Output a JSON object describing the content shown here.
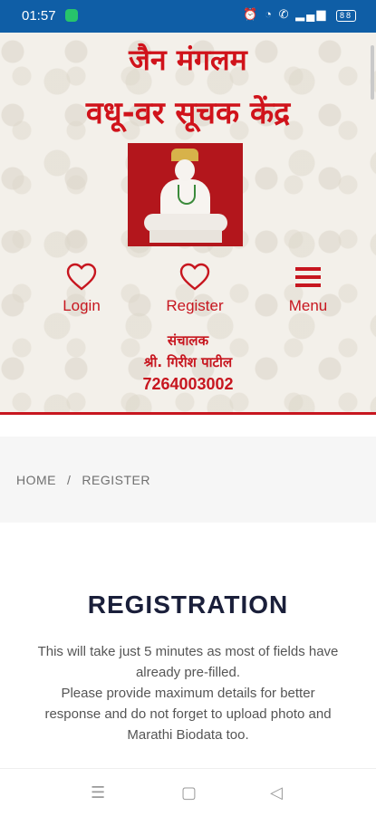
{
  "status_bar": {
    "time": "01:57",
    "battery": "88",
    "icons": [
      "alarm-icon",
      "wifi-icon",
      "call-icon",
      "signal-icon",
      "battery-icon"
    ]
  },
  "header": {
    "title_line1": "जैन मंगलम",
    "title_line2": "वधू-वर सूचक केंद्र",
    "nav": {
      "login": "Login",
      "register": "Register",
      "menu": "Menu"
    },
    "director": {
      "label": "संचालक",
      "name": "श्री. गिरीश पाटील",
      "phone": "7264003002"
    }
  },
  "breadcrumb": {
    "home": "HOME",
    "separator": "/",
    "current": "REGISTER"
  },
  "main": {
    "heading": "REGISTRATION",
    "description_line1": "This will take just 5 minutes as most of fields have",
    "description_line2": "already pre-filled.",
    "description_line3": "Please provide maximum details for better",
    "description_line4": "response and do not forget to upload photo and",
    "description_line5": "Marathi Biodata too."
  },
  "colors": {
    "accent": "#c7161f",
    "status_bar": "#0f5ea6",
    "heading": "#1a1f3a"
  }
}
